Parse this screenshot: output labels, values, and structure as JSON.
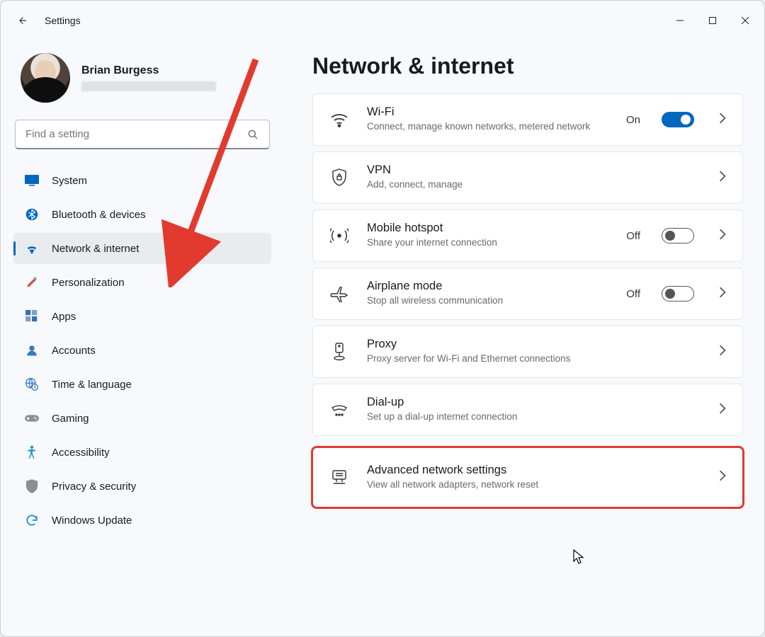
{
  "app": {
    "title": "Settings"
  },
  "user": {
    "name": "Brian Burgess"
  },
  "search": {
    "placeholder": "Find a setting"
  },
  "sidebar": {
    "items": [
      {
        "label": "System",
        "icon": "display-icon"
      },
      {
        "label": "Bluetooth & devices",
        "icon": "bluetooth-icon"
      },
      {
        "label": "Network & internet",
        "icon": "wifi-icon"
      },
      {
        "label": "Personalization",
        "icon": "paintbrush-icon"
      },
      {
        "label": "Apps",
        "icon": "apps-icon"
      },
      {
        "label": "Accounts",
        "icon": "person-icon"
      },
      {
        "label": "Time & language",
        "icon": "globe-clock-icon"
      },
      {
        "label": "Gaming",
        "icon": "gamepad-icon"
      },
      {
        "label": "Accessibility",
        "icon": "accessibility-icon"
      },
      {
        "label": "Privacy & security",
        "icon": "shield-icon"
      },
      {
        "label": "Windows Update",
        "icon": "update-icon"
      }
    ],
    "selected_index": 2
  },
  "main": {
    "title": "Network & internet",
    "cards": [
      {
        "icon": "wifi-icon",
        "title": "Wi-Fi",
        "subtitle": "Connect, manage known networks, metered network",
        "state_label": "On",
        "toggle_on": true
      },
      {
        "icon": "shield-lock-icon",
        "title": "VPN",
        "subtitle": "Add, connect, manage"
      },
      {
        "icon": "hotspot-icon",
        "title": "Mobile hotspot",
        "subtitle": "Share your internet connection",
        "state_label": "Off",
        "toggle_on": false
      },
      {
        "icon": "airplane-icon",
        "title": "Airplane mode",
        "subtitle": "Stop all wireless communication",
        "state_label": "Off",
        "toggle_on": false
      },
      {
        "icon": "proxy-icon",
        "title": "Proxy",
        "subtitle": "Proxy server for Wi-Fi and Ethernet connections"
      },
      {
        "icon": "dialup-icon",
        "title": "Dial-up",
        "subtitle": "Set up a dial-up internet connection"
      },
      {
        "icon": "adapter-icon",
        "title": "Advanced network settings",
        "subtitle": "View all network adapters, network reset",
        "highlight": true
      }
    ]
  },
  "colors": {
    "accent": "#0067c0",
    "annotation": "#e23a2e"
  }
}
